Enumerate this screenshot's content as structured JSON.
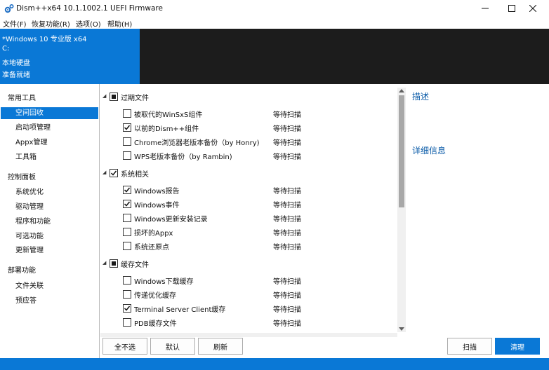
{
  "window": {
    "title": "Dism++x64 10.1.1002.1 UEFI Firmware"
  },
  "menu": [
    "文件(F)",
    "恢复功能(R)",
    "选项(O)",
    "帮助(H)"
  ],
  "header": {
    "lines": [
      "*Windows 10 专业版 x64",
      "C:",
      "本地硬盘",
      "准备就绪"
    ],
    "accent_color": "#0a78d6"
  },
  "sidebar": {
    "groups": [
      {
        "label": "常用工具",
        "items": [
          "空间回收",
          "启动项管理",
          "Appx管理",
          "工具箱"
        ]
      },
      {
        "label": "控制面板",
        "items": [
          "系统优化",
          "驱动管理",
          "程序和功能",
          "可选功能",
          "更新管理"
        ]
      },
      {
        "label": "部署功能",
        "items": [
          "文件关联",
          "预应答"
        ]
      }
    ],
    "selected": "空间回收"
  },
  "content": {
    "groups": [
      {
        "label": "过期文件",
        "state": "partial",
        "items": [
          {
            "label": "被取代的WinSxS组件",
            "status": "等待扫描",
            "checked": false
          },
          {
            "label": "以前的Dism++组件",
            "status": "等待扫描",
            "checked": true
          },
          {
            "label": "Chrome浏览器老版本备份（by Honry)",
            "status": "等待扫描",
            "checked": false
          },
          {
            "label": "WPS老版本备份（by Rambin)",
            "status": "等待扫描",
            "checked": false
          }
        ]
      },
      {
        "label": "系统相关",
        "state": "checked",
        "items": [
          {
            "label": "Windows报告",
            "status": "等待扫描",
            "checked": true
          },
          {
            "label": "Windows事件",
            "status": "等待扫描",
            "checked": true
          },
          {
            "label": "Windows更新安装记录",
            "status": "等待扫描",
            "checked": false
          },
          {
            "label": "损坏的Appx",
            "status": "等待扫描",
            "checked": false
          },
          {
            "label": "系统还原点",
            "status": "等待扫描",
            "checked": false
          }
        ]
      },
      {
        "label": "缓存文件",
        "state": "partial",
        "items": [
          {
            "label": "Windows下载缓存",
            "status": "等待扫描",
            "checked": false
          },
          {
            "label": "传递优化缓存",
            "status": "等待扫描",
            "checked": false
          },
          {
            "label": "Terminal Server Client缓存",
            "status": "等待扫描",
            "checked": true
          },
          {
            "label": "PDB缓存文件",
            "status": "等待扫描",
            "checked": false
          }
        ]
      }
    ]
  },
  "right_panel": {
    "description_title": "描述",
    "details_title": "详细信息"
  },
  "buttons": {
    "select_none": "全不选",
    "default": "默认",
    "refresh": "刷新",
    "scan": "扫描",
    "clean": "清理"
  }
}
